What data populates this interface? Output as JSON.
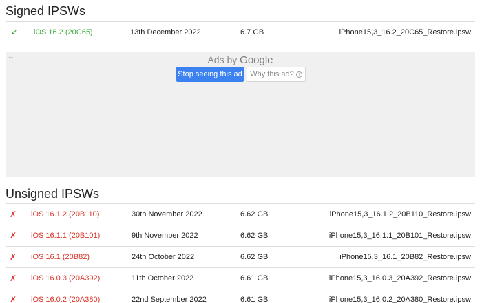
{
  "signed": {
    "title": "Signed IPSWs",
    "rows": [
      {
        "mark": "✓",
        "version": "iOS 16.2 (20C65)",
        "date": "13th December 2022",
        "size": "6.7 GB",
        "file": "iPhone15,3_16.2_20C65_Restore.ipsw"
      }
    ]
  },
  "ad": {
    "back_icon": "←",
    "ads_by": "Ads by",
    "google": "Google",
    "stop_label": "Stop seeing this ad",
    "why_label": "Why this ad?",
    "info_glyph": "i"
  },
  "unsigned": {
    "title": "Unsigned IPSWs",
    "rows": [
      {
        "mark": "✗",
        "version": "iOS 16.1.2 (20B110)",
        "date": "30th November 2022",
        "size": "6.62 GB",
        "file": "iPhone15,3_16.1.2_20B110_Restore.ipsw"
      },
      {
        "mark": "✗",
        "version": "iOS 16.1.1 (20B101)",
        "date": "9th November 2022",
        "size": "6.62 GB",
        "file": "iPhone15,3_16.1.1_20B101_Restore.ipsw"
      },
      {
        "mark": "✗",
        "version": "iOS 16.1 (20B82)",
        "date": "24th October 2022",
        "size": "6.62 GB",
        "file": "iPhone15,3_16.1_20B82_Restore.ipsw"
      },
      {
        "mark": "✗",
        "version": "iOS 16.0.3 (20A392)",
        "date": "11th October 2022",
        "size": "6.61 GB",
        "file": "iPhone15,3_16.0.3_20A392_Restore.ipsw"
      },
      {
        "mark": "✗",
        "version": "iOS 16.0.2 (20A380)",
        "date": "22nd September 2022",
        "size": "6.61 GB",
        "file": "iPhone15,3_16.0.2_20A380_Restore.ipsw"
      }
    ]
  },
  "colors": {
    "signed_green": "#3aaa3a",
    "unsigned_red": "#d9362b",
    "ad_button_blue": "#3b82f0",
    "ad_background": "#f0f0f0"
  }
}
